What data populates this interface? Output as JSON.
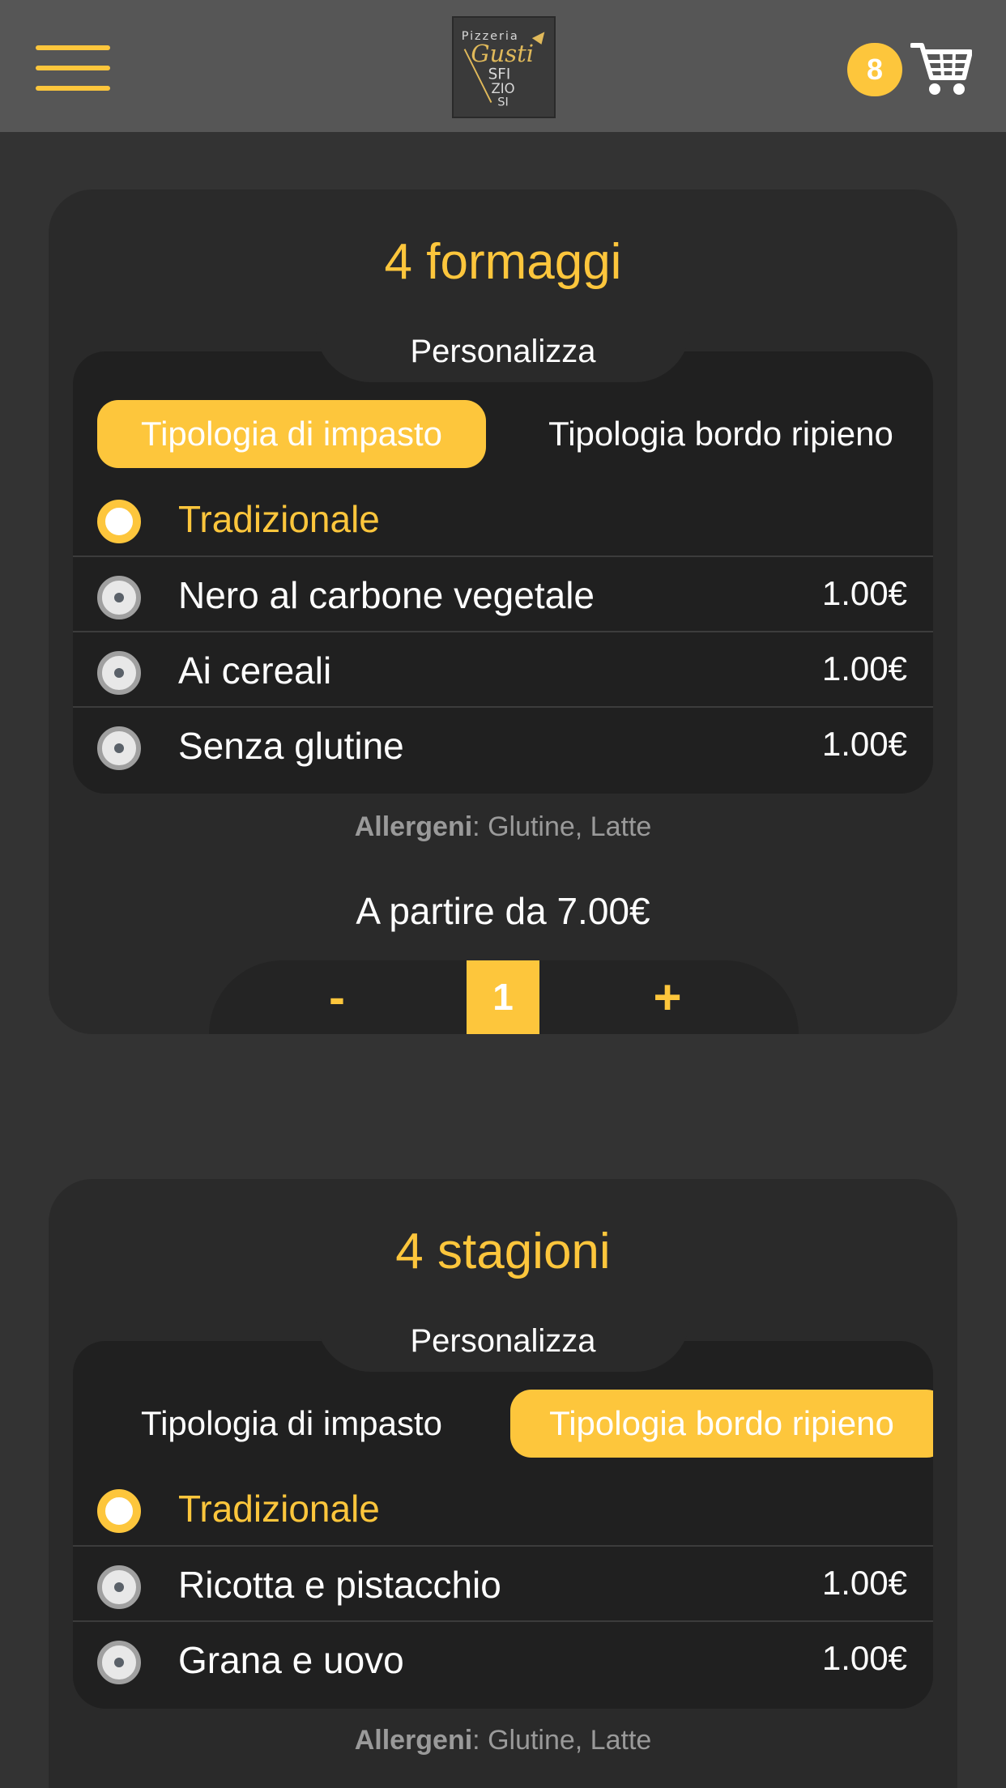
{
  "header": {
    "logo_alt": "Pizzeria Gusti Sfiziosi",
    "cart_count": "8"
  },
  "colors": {
    "accent": "#fdc63c",
    "background": "#333333",
    "header": "#565656",
    "card": "#2a2a2a",
    "panel": "#202020"
  },
  "products": [
    {
      "title": "4 formaggi",
      "customize_label": "Personalizza",
      "tabs": [
        {
          "label": "Tipologia di impasto",
          "active": true
        },
        {
          "label": "Tipologia bordo ripieno",
          "active": false
        }
      ],
      "options": [
        {
          "label": "Tradizionale",
          "price": "",
          "selected": true
        },
        {
          "label": "Nero al carbone vegetale",
          "price": "1.00€",
          "selected": false
        },
        {
          "label": "Ai cereali",
          "price": "1.00€",
          "selected": false
        },
        {
          "label": "Senza glutine",
          "price": "1.00€",
          "selected": false
        }
      ],
      "allergens_label": "Allergeni",
      "allergens_value": ": Glutine, Latte",
      "price_from": "A partire da 7.00€",
      "quantity": {
        "minus": "-",
        "value": "1",
        "plus": "+"
      }
    },
    {
      "title": "4 stagioni",
      "customize_label": "Personalizza",
      "tabs": [
        {
          "label": "Tipologia di impasto",
          "active": false
        },
        {
          "label": "Tipologia bordo ripieno",
          "active": true
        }
      ],
      "options": [
        {
          "label": "Tradizionale",
          "price": "",
          "selected": true
        },
        {
          "label": "Ricotta e pistacchio",
          "price": "1.00€",
          "selected": false
        },
        {
          "label": "Grana e uovo",
          "price": "1.00€",
          "selected": false
        }
      ],
      "allergens_label": "Allergeni",
      "allergens_value": ": Glutine, Latte"
    }
  ]
}
